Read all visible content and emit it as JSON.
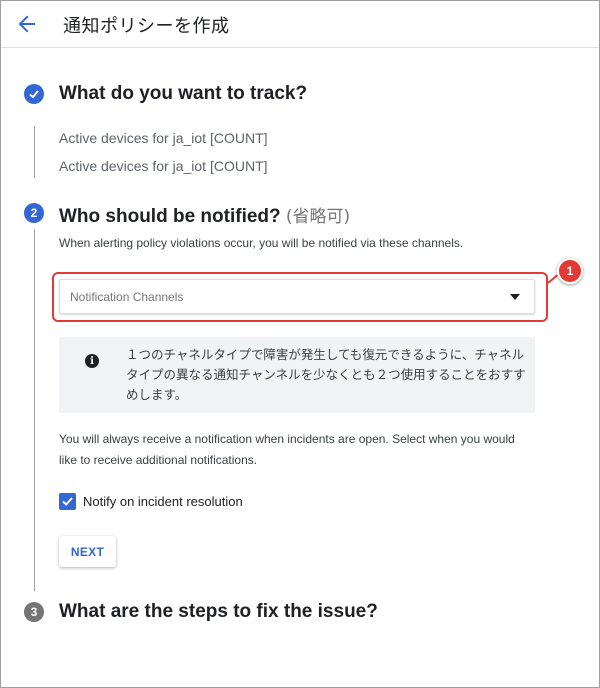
{
  "header": {
    "title": "通知ポリシーを作成",
    "back_icon": "arrow-left-icon"
  },
  "steps": [
    {
      "number": "✓",
      "title": "What do you want to track?",
      "status": "completed",
      "color": "#3367d6"
    },
    {
      "number": "2",
      "title": "Who should be notified?",
      "optional": "(省略可)",
      "status": "active",
      "color": "#3367d6"
    },
    {
      "number": "3",
      "title": "What are the steps to fix the issue?",
      "status": "pending",
      "color": "#757575"
    }
  ],
  "tracking": {
    "items": [
      "Active devices for ja_iot [COUNT]",
      "Active devices for ja_iot [COUNT]"
    ]
  },
  "notify": {
    "help_text": "When alerting policy violations occur, you will be notified via these channels.",
    "dropdown_placeholder": "Notification Channels",
    "callout_number": "1",
    "info_text": "１つのチャネルタイプで障害が発生しても復元できるように、チャネルタイプの異なる通知チャンネルを少なくとも２つ使用することをおすすめします。",
    "incident_text": "You will always receive a notification when incidents are open. Select when you would like to receive additional notifications.",
    "checkbox_label": "Notify on incident resolution",
    "checkbox_checked": true,
    "next_label": "NEXT"
  },
  "colors": {
    "accent": "#3367d6",
    "highlight": "#e53935"
  }
}
